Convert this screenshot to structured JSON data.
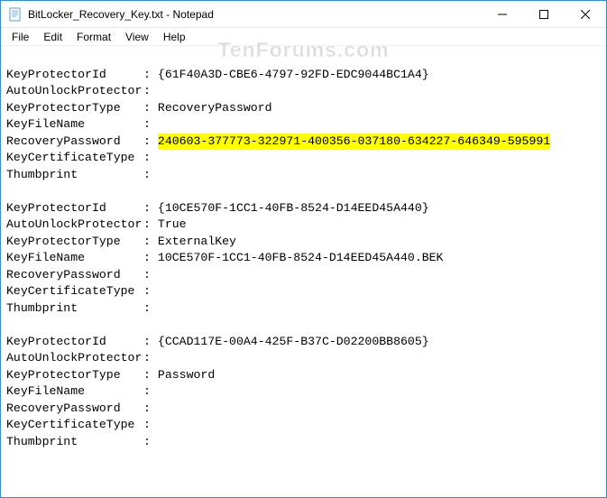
{
  "window": {
    "title": "BitLocker_Recovery_Key.txt - Notepad"
  },
  "menu": {
    "file": "File",
    "edit": "Edit",
    "format": "Format",
    "view": "View",
    "help": "Help"
  },
  "watermark": "TenForums.com",
  "blocks": [
    {
      "KeyProtectorId": "{61F40A3D-CBE6-4797-92FD-EDC9044BC1A4}",
      "AutoUnlockProtector": "",
      "KeyProtectorType": "RecoveryPassword",
      "KeyFileName": "",
      "RecoveryPassword": "240603-377773-322971-400356-037180-634227-646349-595991",
      "RecoveryPasswordHighlighted": true,
      "KeyCertificateType": "",
      "Thumbprint": ""
    },
    {
      "KeyProtectorId": "{10CE570F-1CC1-40FB-8524-D14EED45A440}",
      "AutoUnlockProtector": "True",
      "KeyProtectorType": "ExternalKey",
      "KeyFileName": "10CE570F-1CC1-40FB-8524-D14EED45A440.BEK",
      "RecoveryPassword": "",
      "RecoveryPasswordHighlighted": false,
      "KeyCertificateType": "",
      "Thumbprint": ""
    },
    {
      "KeyProtectorId": "{CCAD117E-00A4-425F-B37C-D02200BB8605}",
      "AutoUnlockProtector": "",
      "KeyProtectorType": "Password",
      "KeyFileName": "",
      "RecoveryPassword": "",
      "RecoveryPasswordHighlighted": false,
      "KeyCertificateType": "",
      "Thumbprint": ""
    }
  ],
  "labels": {
    "KeyProtectorId": "KeyProtectorId",
    "AutoUnlockProtector": "AutoUnlockProtector",
    "KeyProtectorType": "KeyProtectorType",
    "KeyFileName": "KeyFileName",
    "RecoveryPassword": "RecoveryPassword",
    "KeyCertificateType": "KeyCertificateType",
    "Thumbprint": "Thumbprint"
  }
}
